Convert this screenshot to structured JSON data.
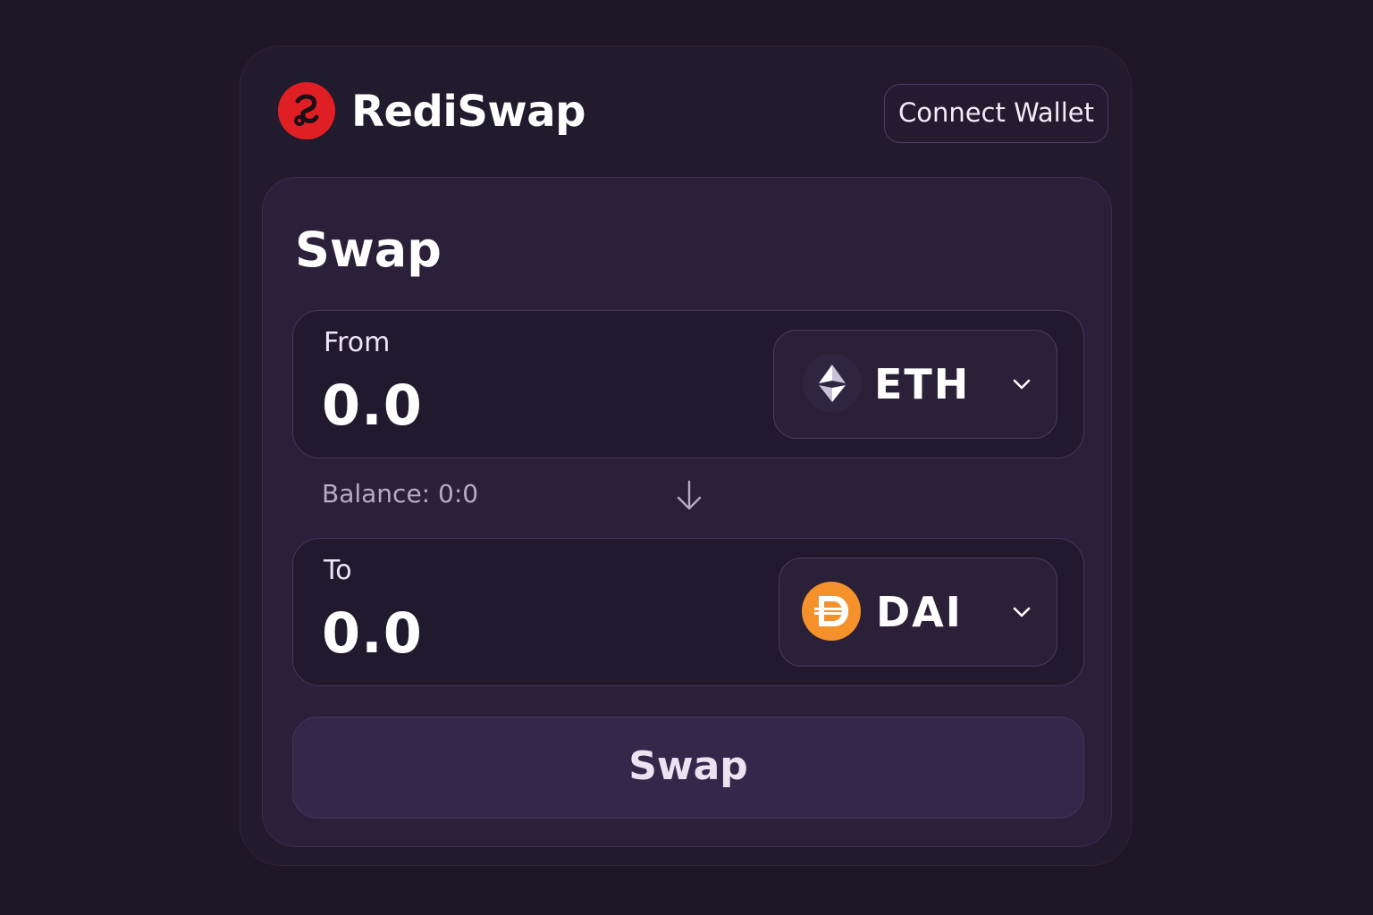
{
  "brand": {
    "name": "RediSwap",
    "logo_icon": "rediswap-logo-icon",
    "logo_color": "#e01f24"
  },
  "header": {
    "connect_wallet_label": "Connect Wallet"
  },
  "swap": {
    "title": "Swap",
    "from": {
      "label": "From",
      "amount": "0.0",
      "token_symbol": "ETH",
      "token_icon": "ethereum-icon"
    },
    "balance_text": "Balance: 0:0",
    "flip_icon": "arrow-down-icon",
    "to": {
      "label": "To",
      "amount": "0.0",
      "token_symbol": "DAI",
      "token_icon": "dai-icon",
      "token_color": "#f5912a"
    },
    "submit_label": "Swap"
  },
  "colors": {
    "background": "#1e1727",
    "card": "#2a2039",
    "panel": "#211a2e",
    "accent_red": "#e01f24",
    "dai_orange": "#f5912a"
  }
}
